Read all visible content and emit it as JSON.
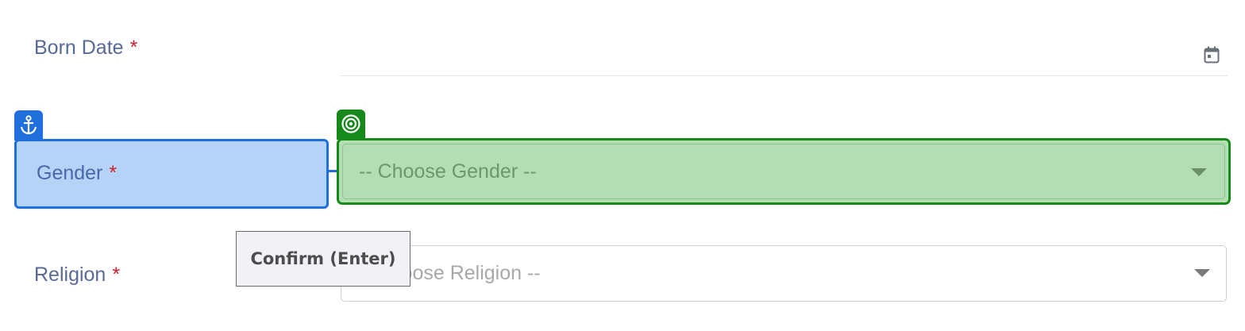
{
  "form": {
    "born_date": {
      "label": "Born Date",
      "required_mark": "*"
    },
    "gender": {
      "label": "Gender",
      "required_mark": "*",
      "placeholder": "-- Choose Gender --"
    },
    "religion": {
      "label": "Religion",
      "required_mark": "*",
      "placeholder": "-- Choose Religion --"
    }
  },
  "overlay": {
    "anchor_icon": "anchor-icon",
    "target_icon": "target-icon",
    "anchor_color": "#1f6fdc",
    "target_color": "#158a1b",
    "tooltip": "Confirm (Enter)"
  },
  "icons": {
    "calendar": "calendar-icon",
    "dropdown": "chevron-down-icon"
  }
}
